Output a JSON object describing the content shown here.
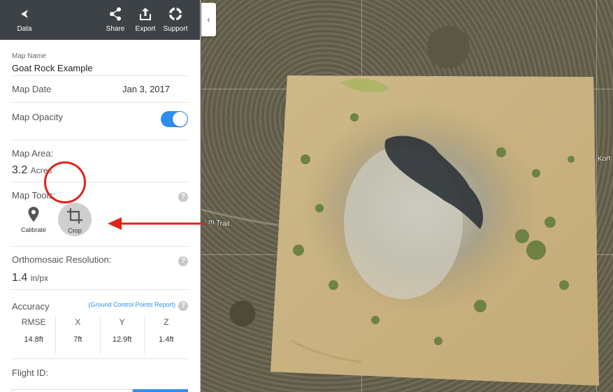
{
  "topbar": {
    "back": {
      "label": "Data",
      "icon": "back-arrow-icon"
    },
    "share": {
      "label": "Share",
      "icon": "share-icon"
    },
    "export": {
      "label": "Export",
      "icon": "export-icon"
    },
    "support": {
      "label": "Support",
      "icon": "lifebuoy-icon"
    }
  },
  "map_name": {
    "label": "Map Name",
    "value": "Goat Rock Example"
  },
  "map_date": {
    "label": "Map Date",
    "value": "Jan 3, 2017"
  },
  "map_opacity": {
    "label": "Map Opacity",
    "enabled": true
  },
  "map_area": {
    "label": "Map Area:",
    "value": "3.2",
    "unit": "Acres"
  },
  "map_tools": {
    "label": "Map Tools:",
    "help": "?",
    "tools": [
      {
        "label": "Calibrate",
        "icon": "location-pin-icon"
      },
      {
        "label": "Crop",
        "icon": "crop-icon",
        "highlighted": true
      }
    ]
  },
  "resolution": {
    "label": "Orthomosaic Resolution:",
    "value": "1.4",
    "unit": "in/px",
    "help": "?"
  },
  "accuracy": {
    "label": "Accuracy",
    "link": "(Ground Control Points Report)",
    "help": "?",
    "columns": [
      {
        "header": "RMSE",
        "value": "14.8ft"
      },
      {
        "header": "X",
        "value": "7ft"
      },
      {
        "header": "Y",
        "value": "12.9ft"
      },
      {
        "header": "Z",
        "value": "1.4ft"
      }
    ]
  },
  "flight": {
    "label": "Flight ID:"
  },
  "map": {
    "collapse_icon": "‹",
    "road_labels": [
      "Kort",
      "m Trail"
    ]
  },
  "colors": {
    "accent": "#2d8ef0",
    "annotation": "#e2231a",
    "topbar": "#3d4247"
  }
}
